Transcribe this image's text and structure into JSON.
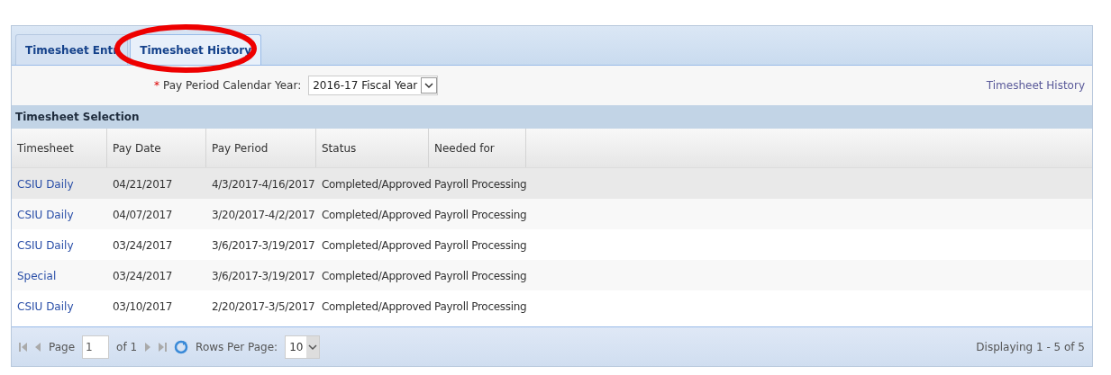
{
  "tabs": [
    {
      "label": "Timesheet Entr",
      "selected": false,
      "circled": false
    },
    {
      "label": "Timesheet History",
      "selected": true,
      "circled": true
    }
  ],
  "filter": {
    "label": "Pay Period Calendar Year:",
    "required_mark": "*",
    "value": "2016-17 Fiscal Year"
  },
  "link": "Timesheet History",
  "section_title": "Timesheet Selection",
  "table": {
    "columns": [
      "Timesheet",
      "Pay Date",
      "Pay Period",
      "Status",
      "Needed for"
    ],
    "rows": [
      {
        "cells": [
          "CSIU Daily",
          "04/21/2017",
          "4/3/2017-4/16/2017",
          "Completed/Approved",
          "Payroll Processing"
        ],
        "selected": true
      },
      {
        "cells": [
          "CSIU Daily",
          "04/07/2017",
          "3/20/2017-4/2/2017",
          "Completed/Approved",
          "Payroll Processing"
        ],
        "selected": false
      },
      {
        "cells": [
          "CSIU Daily",
          "03/24/2017",
          "3/6/2017-3/19/2017",
          "Completed/Approved",
          "Payroll Processing"
        ],
        "selected": false
      },
      {
        "cells": [
          "Special",
          "03/24/2017",
          "3/6/2017-3/19/2017",
          "Completed/Approved",
          "Payroll Processing"
        ],
        "selected": false
      },
      {
        "cells": [
          "CSIU Daily",
          "03/10/2017",
          "2/20/2017-3/5/2017",
          "Completed/Approved",
          "Payroll Processing"
        ],
        "selected": false
      }
    ]
  },
  "pager": {
    "page_label": "Page",
    "page": "1",
    "of": "of 1",
    "rows_label": "Rows Per Page:",
    "rows_value": "10",
    "displaying": "Displaying 1 - 5 of 5"
  }
}
